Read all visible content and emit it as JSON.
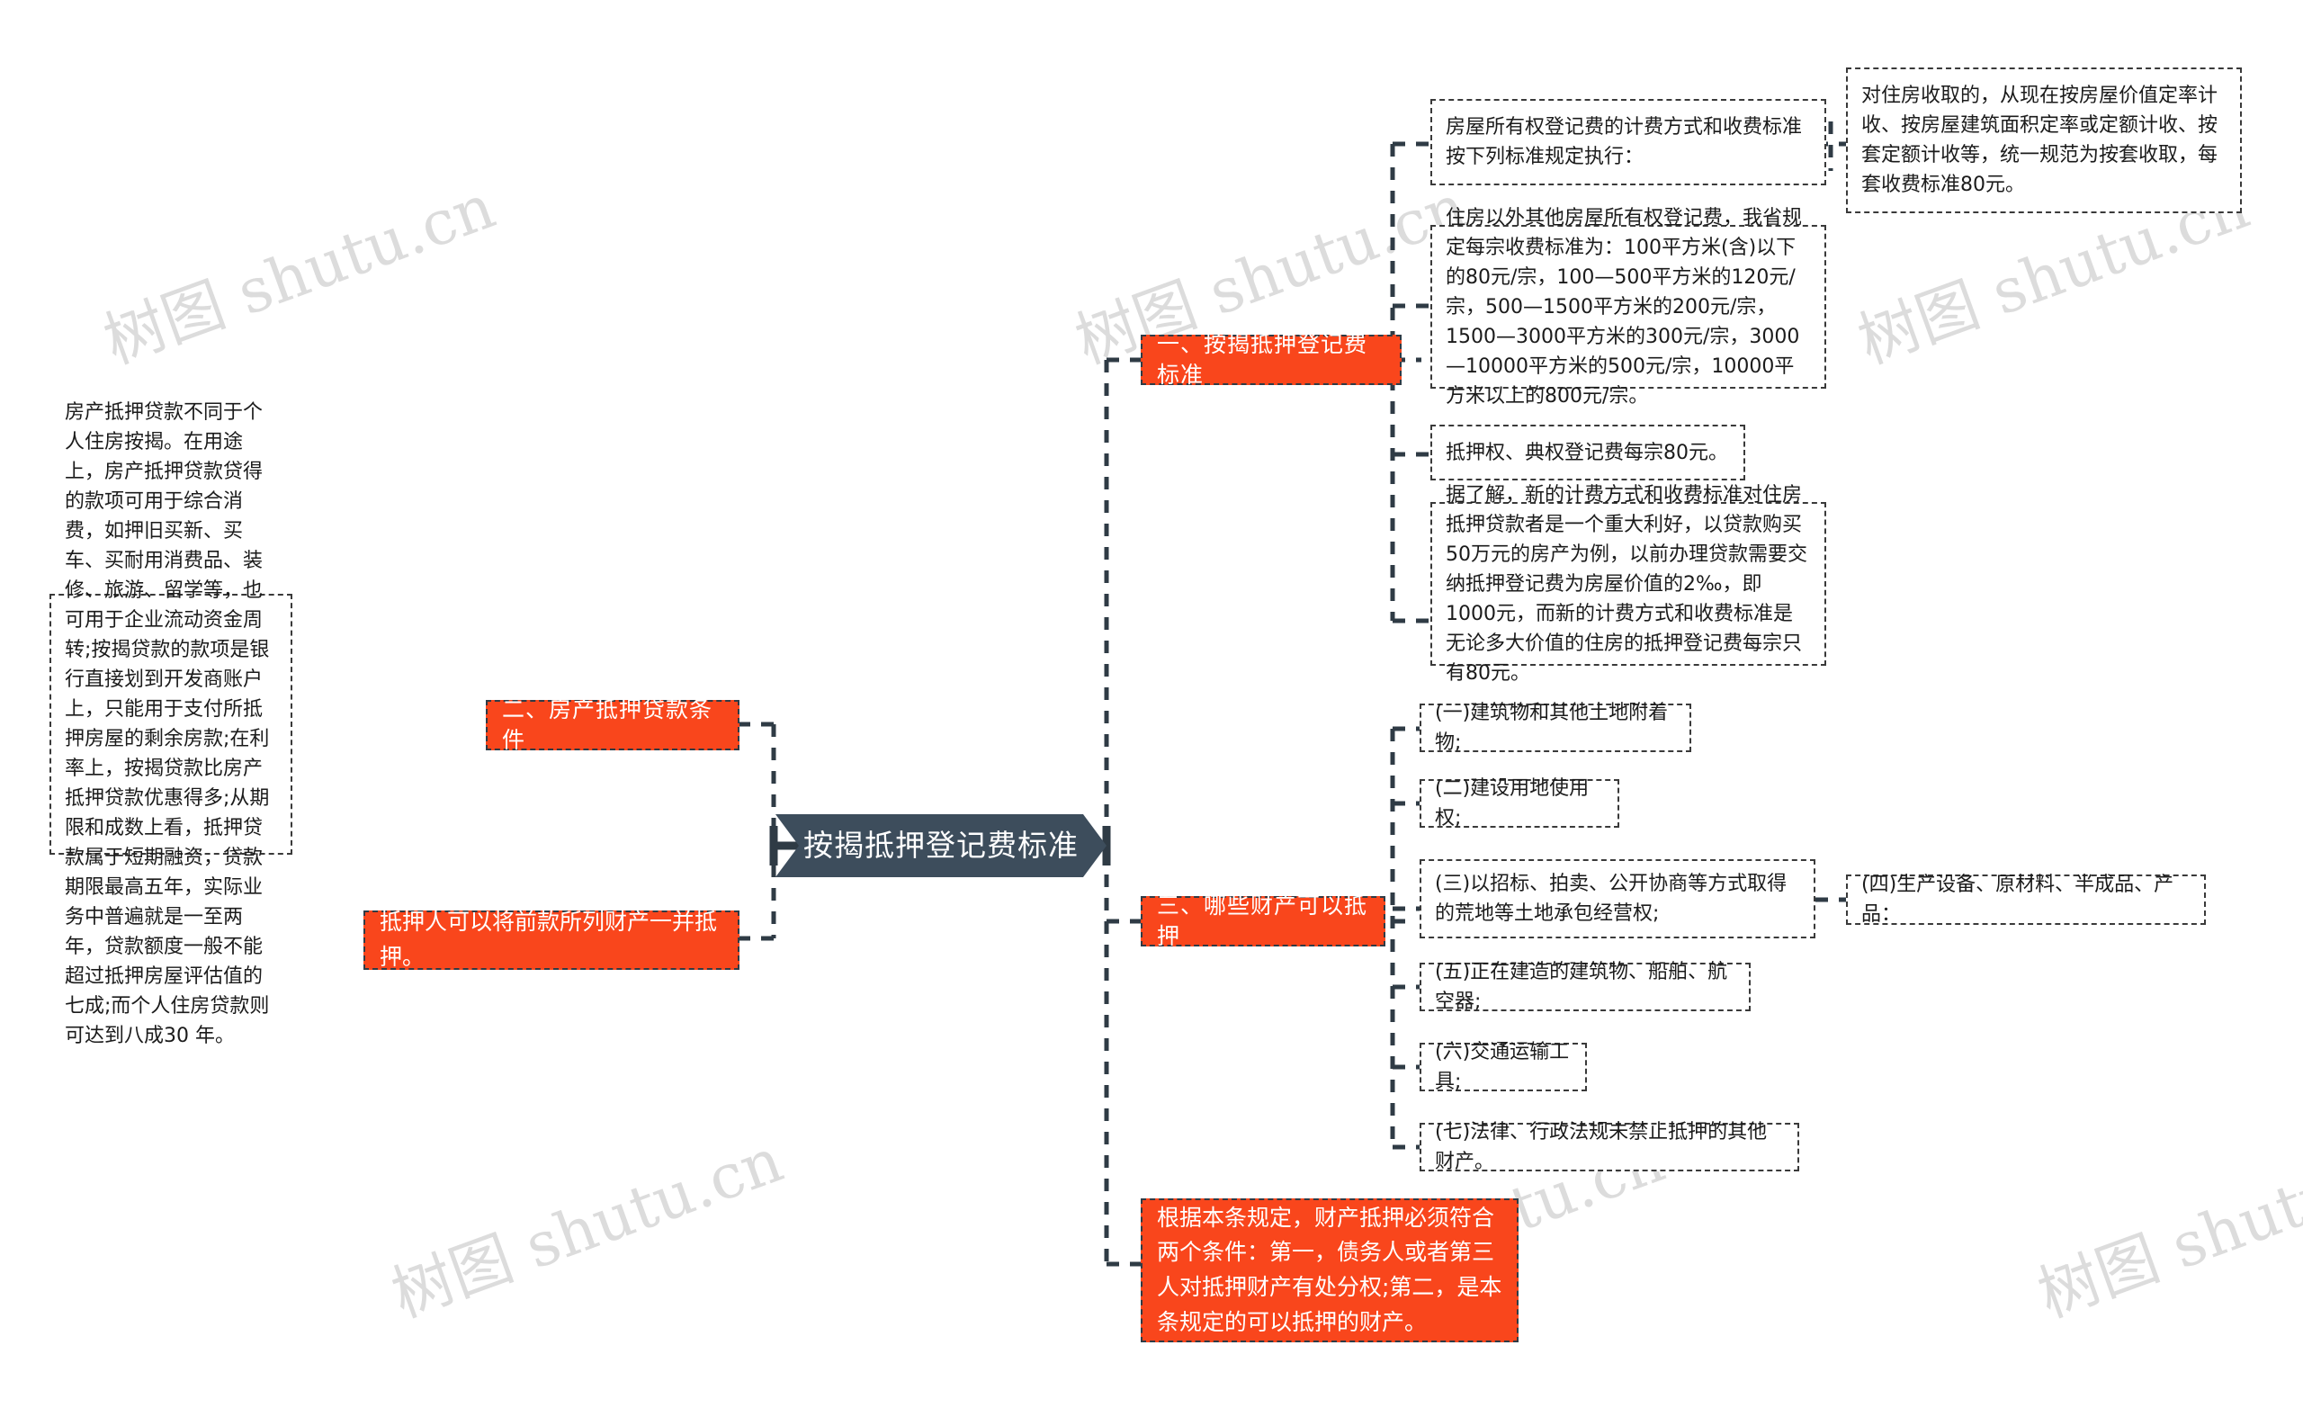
{
  "meta": {
    "watermark_text": "树图 shutu.cn",
    "watermark_color": "#dcdcdc",
    "accent_orange": "#f9461c",
    "root_color": "#3d4d5c",
    "canvas_background": "#ffffff"
  },
  "root": {
    "label": "按揭抵押登记费标准"
  },
  "branches": [
    {
      "id": "branch-1",
      "label": "一、按揭抵押登记费标准",
      "children": [
        {
          "id": "b1-c1",
          "text": "房屋所有权登记费的计费方式和收费标准按下列标准规定执行：",
          "children": [
            {
              "id": "b1-c1-g1",
              "text": "对住房收取的，从现在按房屋价值定率计收、按房屋建筑面积定率或定额计收、按套定额计收等，统一规范为按套收取，每套收费标准80元。"
            }
          ]
        },
        {
          "id": "b1-c2",
          "text": "住房以外其他房屋所有权登记费，我省规定每宗收费标准为：100平方米(含)以下的80元/宗，100—500平方米的120元/宗，500—1500平方米的200元/宗，1500—3000平方米的300元/宗，3000—10000平方米的500元/宗，10000平方米以上的800元/宗。"
        },
        {
          "id": "b1-c3",
          "text": "抵押权、典权登记费每宗80元。"
        },
        {
          "id": "b1-c4",
          "text": "据了解，新的计费方式和收费标准对住房抵押贷款者是一个重大利好，以贷款购买50万元的房产为例，以前办理贷款需要交纳抵押登记费为房屋价值的2‰，即1000元，而新的计费方式和收费标准是无论多大价值的住房的抵押登记费每宗只有80元。"
        }
      ]
    },
    {
      "id": "branch-2",
      "label": "二、房产抵押贷款条件",
      "children": [
        {
          "id": "b2-c1",
          "text": "房产抵押贷款不同于个人住房按揭。在用途上，房产抵押贷款贷得的款项可用于综合消费，如押旧买新、买车、买耐用消费品、装修、旅游、留学等，也可用于企业流动资金周转;按揭贷款的款项是银行直接划到开发商账户上，只能用于支付所抵押房屋的剩余房款;在利率上，按揭贷款比房产抵押贷款优惠得多;从期限和成数上看，抵押贷款属于短期融资，贷款期限最高五年，实际业务中普遍就是一至两年，贷款额度一般不能超过抵押房屋评估值的七成;而个人住房贷款则可达到八成30 年。"
        }
      ]
    },
    {
      "id": "branch-2b",
      "label": "抵押人可以将前款所列财产一并抵押。"
    },
    {
      "id": "branch-3",
      "label": "三、哪些财产可以抵押",
      "children": [
        {
          "id": "b3-c1",
          "text": "(一)建筑物和其他土地附着物;"
        },
        {
          "id": "b3-c2",
          "text": "(二)建设用地使用权;"
        },
        {
          "id": "b3-c3",
          "text": "(三)以招标、拍卖、公开协商等方式取得的荒地等土地承包经营权;",
          "children": [
            {
              "id": "b3-c3-g1",
              "text": "(四)生产设备、原材料、半成品、产品："
            }
          ]
        },
        {
          "id": "b3-c4",
          "text": "(五)正在建造的建筑物、船舶、航空器;"
        },
        {
          "id": "b3-c5",
          "text": "(六)交通运输工具;"
        },
        {
          "id": "b3-c6",
          "text": "(七)法律、行政法规未禁止抵押的其他财产。"
        }
      ]
    },
    {
      "id": "branch-4",
      "label": "根据本条规定，财产抵押必须符合两个条件：第一，债务人或者第三人对抵押财产有处分权;第二，是本条规定的可以抵押的财产。"
    }
  ]
}
